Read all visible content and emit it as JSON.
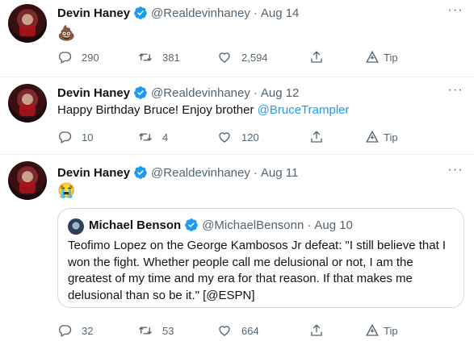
{
  "tweets": [
    {
      "author_name": "Devin Haney",
      "handle": "@Realdevinhaney",
      "separator": "·",
      "date": "Aug 14",
      "emoji": "💩",
      "replies": "290",
      "retweets": "381",
      "likes": "2,594",
      "tip_label": "Tip"
    },
    {
      "author_name": "Devin Haney",
      "handle": "@Realdevinhaney",
      "separator": "·",
      "date": "Aug 12",
      "text": "Happy Birthday Bruce! Enjoy brother ",
      "mention": "@BruceTrampler",
      "replies": "10",
      "retweets": "4",
      "likes": "120",
      "tip_label": "Tip"
    },
    {
      "author_name": "Devin Haney",
      "handle": "@Realdevinhaney",
      "separator": "·",
      "date": "Aug 11",
      "emoji": "😭",
      "replies": "32",
      "retweets": "53",
      "likes": "664",
      "tip_label": "Tip",
      "quote": {
        "author_name": "Michael Benson",
        "handle": "@MichaelBensonn",
        "separator": "·",
        "date": "Aug 10",
        "text": "Teofimo Lopez on the George Kambosos Jr defeat: \"I still believe that I won the fight. Whether people call me delusional or not, I am the greatest of my time and my era for that reason. If that makes me delusional than so be it.\" [@ESPN]"
      }
    }
  ],
  "icons": {
    "verified": "verified-badge-icon",
    "more": "more-options-icon",
    "reply": "reply-icon",
    "retweet": "retweet-icon",
    "like": "heart-icon",
    "share": "share-icon",
    "tip": "tip-icon"
  },
  "colors": {
    "accent": "#1d9bf0",
    "secondary_text": "#536471",
    "border": "#eff3f4"
  }
}
